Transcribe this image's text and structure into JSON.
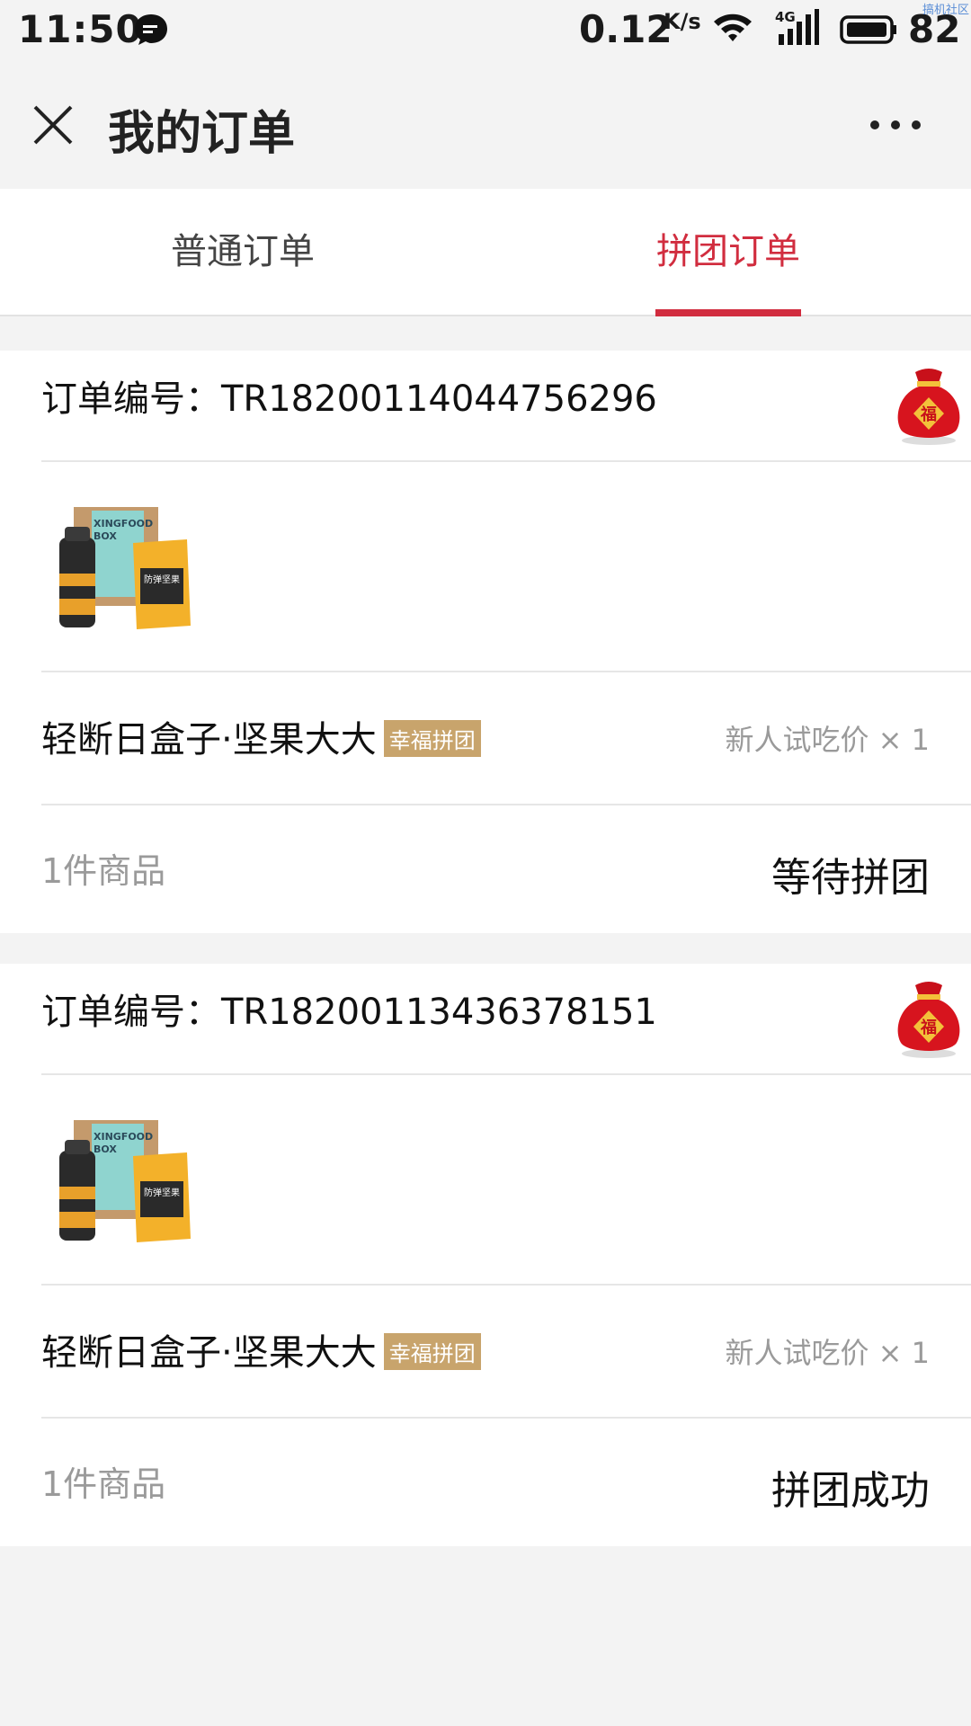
{
  "status_bar": {
    "time": "11:50",
    "speed": "0.12",
    "speed_unit": "K/s",
    "network": "4G",
    "battery": "82",
    "watermark": "搞机社区"
  },
  "nav": {
    "title": "我的订单",
    "close_icon": "close-icon",
    "more_icon": "more-icon"
  },
  "tabs": [
    {
      "label": "普通订单",
      "active": false
    },
    {
      "label": "拼团订单",
      "active": true
    }
  ],
  "colors": {
    "accent": "#d12d3f",
    "badge": "#c8a46c",
    "muted": "#9a9a9a"
  },
  "orders": [
    {
      "order_label": "订单编号：TR18200114044756296",
      "product_name": "轻断日盒子·坚果大大",
      "badge": "幸福拼团",
      "price_qty": "新人试吃价 × 1",
      "item_count": "1件商品",
      "status": "等待拼团"
    },
    {
      "order_label": "订单编号：TR18200113436378151",
      "product_name": "轻断日盒子·坚果大大",
      "badge": "幸福拼团",
      "price_qty": "新人试吃价 × 1",
      "item_count": "1件商品",
      "status": "拼团成功"
    }
  ],
  "product_image_text": {
    "box_line1": "XINGFOOD",
    "box_line2": "BOX",
    "pouch": "防弹坚果"
  }
}
